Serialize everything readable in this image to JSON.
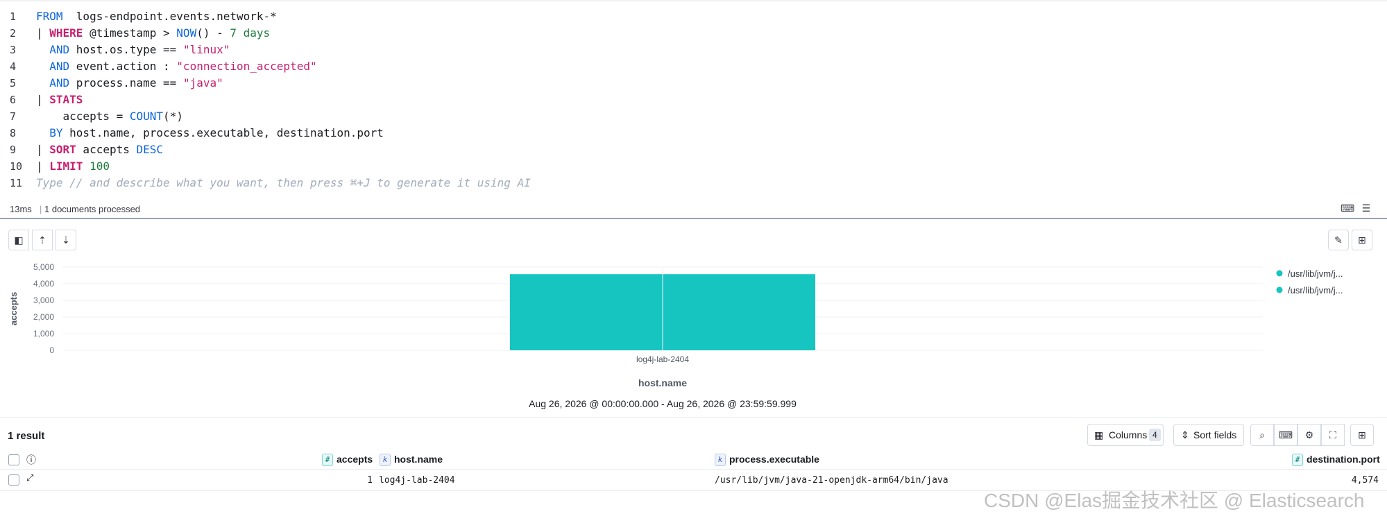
{
  "editor": {
    "lines": [
      {
        "n": "1",
        "parts": [
          {
            "t": "FROM",
            "c": "kw2"
          },
          {
            "t": "  logs-endpoint.events.network-*",
            "c": "plain"
          }
        ]
      },
      {
        "n": "2",
        "parts": [
          {
            "t": "| ",
            "c": "plain"
          },
          {
            "t": "WHERE",
            "c": "kw"
          },
          {
            "t": " @timestamp > ",
            "c": "plain"
          },
          {
            "t": "NOW",
            "c": "fn"
          },
          {
            "t": "() - ",
            "c": "plain"
          },
          {
            "t": "7 days",
            "c": "dur"
          }
        ]
      },
      {
        "n": "3",
        "parts": [
          {
            "t": "  AND",
            "c": "kw2"
          },
          {
            "t": " host.os.type == ",
            "c": "plain"
          },
          {
            "t": "\"linux\"",
            "c": "str"
          }
        ]
      },
      {
        "n": "4",
        "parts": [
          {
            "t": "  AND",
            "c": "kw2"
          },
          {
            "t": " event.action : ",
            "c": "plain"
          },
          {
            "t": "\"connection_accepted\"",
            "c": "str"
          }
        ]
      },
      {
        "n": "5",
        "parts": [
          {
            "t": "  AND",
            "c": "kw2"
          },
          {
            "t": " process.name == ",
            "c": "plain"
          },
          {
            "t": "\"java\"",
            "c": "str"
          }
        ]
      },
      {
        "n": "6",
        "parts": [
          {
            "t": "| ",
            "c": "plain"
          },
          {
            "t": "STATS",
            "c": "kw"
          }
        ]
      },
      {
        "n": "7",
        "parts": [
          {
            "t": "    accepts = ",
            "c": "plain"
          },
          {
            "t": "COUNT",
            "c": "fn"
          },
          {
            "t": "(*)",
            "c": "plain"
          }
        ]
      },
      {
        "n": "8",
        "parts": [
          {
            "t": "  BY",
            "c": "kw2"
          },
          {
            "t": " host.name, process.executable, destination.port",
            "c": "plain"
          }
        ]
      },
      {
        "n": "9",
        "parts": [
          {
            "t": "| ",
            "c": "plain"
          },
          {
            "t": "SORT",
            "c": "kw"
          },
          {
            "t": " accepts ",
            "c": "plain"
          },
          {
            "t": "DESC",
            "c": "kw2"
          }
        ]
      },
      {
        "n": "10",
        "parts": [
          {
            "t": "| ",
            "c": "plain"
          },
          {
            "t": "LIMIT",
            "c": "kw"
          },
          {
            "t": " ",
            "c": "plain"
          },
          {
            "t": "100",
            "c": "num"
          }
        ]
      },
      {
        "n": "11",
        "parts": [
          {
            "t": "Type // and describe what you want, then press ⌘+J to generate it using AI",
            "c": "hint"
          }
        ]
      }
    ]
  },
  "status": {
    "time": "13ms",
    "docs": "1 documents processed"
  },
  "chart_data": {
    "type": "bar",
    "categories": [
      "log4j-lab-2404"
    ],
    "values": [
      4574
    ],
    "xlabel": "host.name",
    "ylabel": "accepts",
    "ylim": [
      0,
      5000
    ],
    "yticks": [
      "5,000",
      "4,000",
      "3,000",
      "2,000",
      "1,000",
      "0"
    ],
    "legend": [
      "/usr/lib/jvm/j...",
      "/usr/lib/jvm/j..."
    ],
    "legend_position": "right",
    "color": "#16c5c0",
    "time_range": "Aug 26, 2026 @ 00:00:00.000 - Aug 26, 2026 @ 23:59:59.999"
  },
  "results": {
    "count_label": "1 result",
    "columns_label": "Columns",
    "columns_count": "4",
    "sort_label": "Sort fields",
    "headers": {
      "accepts": "accepts",
      "host": "host.name",
      "exe": "process.executable",
      "port": "destination.port"
    },
    "row": {
      "accepts": "1",
      "host": "log4j-lab-2404",
      "exe": "/usr/lib/jvm/java-21-openjdk-arm64/bin/java",
      "port": "4,574"
    }
  },
  "watermark": "CSDN @Elas掘金技术社区 @ Elasticsearch"
}
